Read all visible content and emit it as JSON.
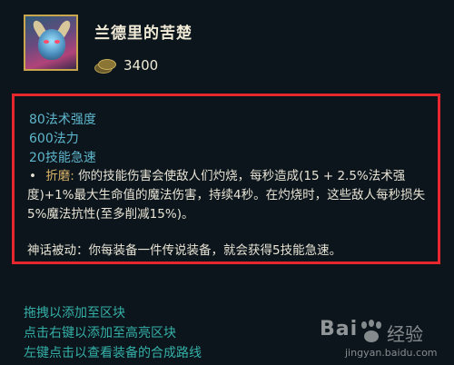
{
  "item": {
    "name": "兰德里的苦楚",
    "price": "3400",
    "icon": "liandry-anguish-icon"
  },
  "stats": [
    "80法术强度",
    "600法力",
    "20技能急速"
  ],
  "passive": {
    "name": "折磨:",
    "text": "你的技能伤害会使敌人们灼烧，每秒造成(15 + 2.5%法术强度)+1%最大生命值的魔法伤害，持续4秒。在灼烧时，这些敌人每秒损失5%魔法抗性(至多削减15%)。"
  },
  "mythic_passive": "神话被动：你每装备一件传说装备，就会获得5技能急速。",
  "hints": [
    "拖拽以添加至区块",
    "点击右键以添加至高亮区块",
    "左键点击以查看装备的合成路线"
  ],
  "watermark": {
    "brand_left": "Bai",
    "brand_right": "经验",
    "url": "jingyan.baidu.com"
  },
  "colors": {
    "background": "#0b151b",
    "stat_blue": "#5fb6cc",
    "hint_teal": "#35b0a8",
    "highlight_box": "#e8262d",
    "gold_frame": "#c8a64e"
  }
}
